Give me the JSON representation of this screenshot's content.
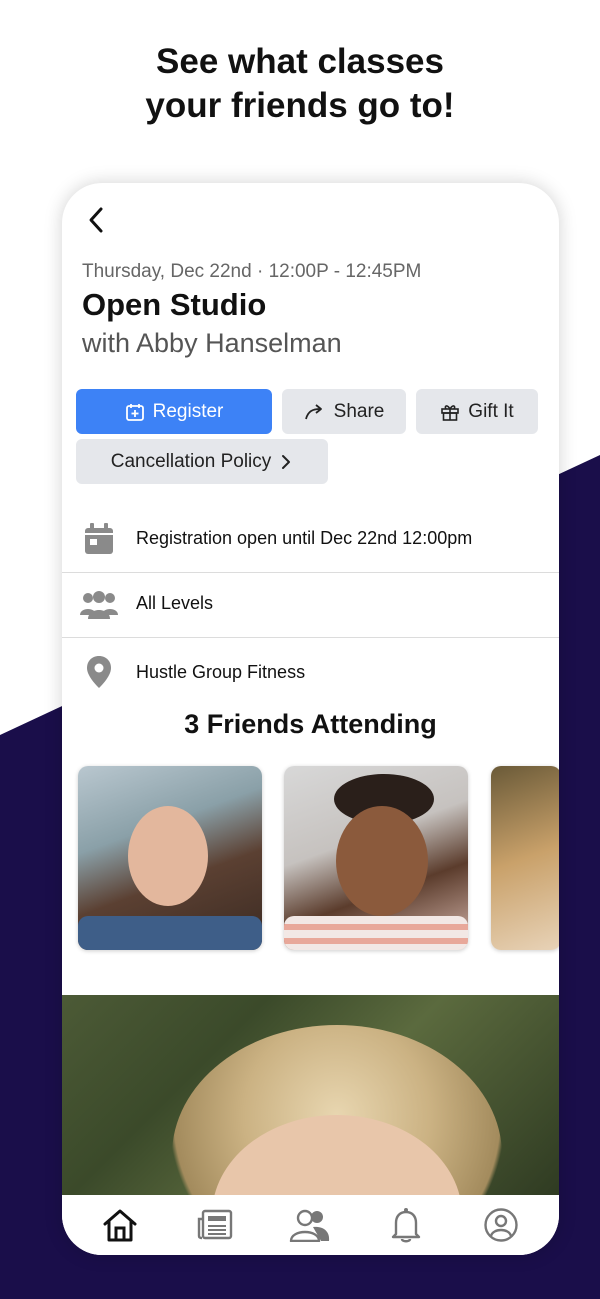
{
  "promo": {
    "headline_line1": "See what classes",
    "headline_line2": "your friends go to!"
  },
  "colors": {
    "accent": "#3d82f6",
    "background_dark": "#1a0e4a",
    "button_gray": "#e5e7eb"
  },
  "event": {
    "datetime": "Thursday, Dec 22nd · 12:00P - 12:45PM",
    "title": "Open Studio",
    "instructor": "with Abby Hanselman"
  },
  "actions": {
    "register_label": "Register",
    "share_label": "Share",
    "gift_label": "Gift It",
    "cancellation_label": "Cancellation Policy"
  },
  "details": {
    "registration": "Registration open until Dec 22nd 12:00pm",
    "level": "All Levels",
    "location": "Hustle Group Fitness"
  },
  "friends": {
    "heading": "3 Friends Attending"
  },
  "tabs": [
    {
      "icon": "home-icon"
    },
    {
      "icon": "news-icon"
    },
    {
      "icon": "friends-icon"
    },
    {
      "icon": "bell-icon"
    },
    {
      "icon": "profile-icon"
    }
  ]
}
